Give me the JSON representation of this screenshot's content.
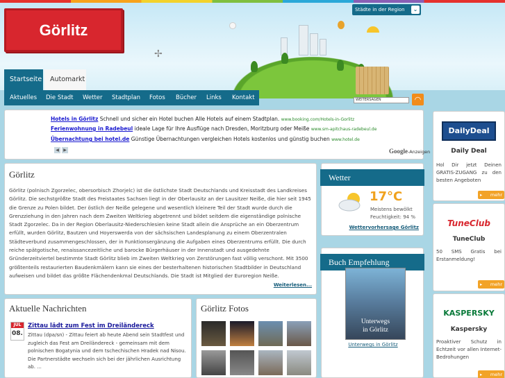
{
  "site": {
    "logo_text": "Görlitz"
  },
  "region_select": {
    "label": "Städte in der Region"
  },
  "nav_main": {
    "tabs": [
      {
        "label": "Startseite"
      },
      {
        "label": "Automarkt"
      }
    ]
  },
  "nav_sub": {
    "items": [
      {
        "label": "Aktuelles"
      },
      {
        "label": "Die Stadt"
      },
      {
        "label": "Wetter"
      },
      {
        "label": "Stadtplan"
      },
      {
        "label": "Fotos"
      },
      {
        "label": "Bücher"
      },
      {
        "label": "Links"
      },
      {
        "label": "Kontakt"
      }
    ]
  },
  "share": {
    "label": "WEITERSAGEN"
  },
  "ads": {
    "items": [
      {
        "title": "Hotels in Görlitz",
        "text": "Schnell und sicher ein Hotel buchen Alle Hotels auf einem Stadtplan.",
        "url": "www.booking.com/Hotels-in-Gorlitz"
      },
      {
        "title": "Ferienwohnung in Radebeul",
        "text": "ideale Lage für Ihre Ausflüge nach Dresden, Moritzburg oder Meiße",
        "url": "www.sm-apitchaus-radebeul.de"
      },
      {
        "title": "Übernachtung bei hotel.de",
        "text": "Günstige Übernachtungen vergleichen Hotels kostenlos und günstig buchen",
        "url": "www.hotel.de"
      }
    ],
    "credit_brand": "Google",
    "credit_text": "-Anzeigen"
  },
  "intro": {
    "title": "Görlitz",
    "text": "Görlitz (polnisch Zgorzelec, obersorbisch Zhorjelc) ist die östlichste Stadt Deutschlands und Kreisstadt des Landkreises Görlitz. Die sechstgrößte Stadt des Freistaates Sachsen liegt in der Oberlausitz an der Lausitzer Neiße, die hier seit 1945 die Grenze zu Polen bildet. Der östlich der Neiße gelegene und wesentlich kleinere Teil der Stadt wurde durch die Grenzziehung in den Jahren nach dem Zweiten Weltkrieg abgetrennt und bildet seitdem die eigenständige polnische Stadt Zgorzelec. Da in der Region Oberlausitz-Niederschlesien keine Stadt allein die Ansprüche an ein Oberzentrum erfüllt, wurden Görlitz, Bautzen und Hoyerswerda von der sächsischen Landesplanung zu einem Oberzentralen Städteverbund zusammengeschlossen, der in Funktionsergänzung die Aufgaben eines Oberzentrums erfüllt. Die durch reiche spätgotische, renaissancezeitliche und barocke Bürgerhäuser in der Innenstadt und ausgedehnte Gründerzeitviertel bestimmte Stadt Görlitz blieb im Zweiten Weltkrieg von Zerstörungen fast völlig verschont. Mit 3500 größtenteils restaurierten Baudenkmälern kann sie eines der besterhaltenen historischen Stadtbilder in Deutschland aufweisen und bildet das größte Flächendenkmal Deutschlands. Die Stadt ist Mitglied der Euroregion Neiße.",
    "more": "Weiterlesen..."
  },
  "news": {
    "title": "Aktuelle Nachrichten",
    "items": [
      {
        "month": "JUL",
        "day": "08.",
        "headline": "Zittau lädt zum Fest im Dreiländereck",
        "body": "Zittau (dpa/sn) - Zittau feiert ab heute Abend sein Stadtfest und zugleich das Fest am Dreiländereck - gemeinsam mit dem polnischen Bogatynia und dem tschechischen Hradek nad Nisou. Die Partnerstädte wechseln sich bei der jährlichen Ausrichtung ab. ..."
      }
    ]
  },
  "fotos": {
    "title": "Görlitz Fotos"
  },
  "weather": {
    "title": "Wetter",
    "temp": "17°C",
    "condition": "Meistens bewölkt",
    "humidity": "Feuchtigkeit: 94 %",
    "link": "Wettervorhersage Görlitz"
  },
  "book": {
    "title": "Buch Empfehlung",
    "cover_title_1": "Unterwegs",
    "cover_title_2": "in Görlitz",
    "link": "Unterwegs in Görlitz"
  },
  "sidebar": {
    "more_label": "mehr",
    "items": [
      {
        "logo": "DailyDeal",
        "name": "Daily Deal",
        "desc": "Hol Dir jetzt Deinen GRATIS-ZUGANG zu den besten Angeboten"
      },
      {
        "logo": "TuneClub",
        "name": "TuneClub",
        "desc": "50 SMS Gratis bei Erstanmeldung!"
      },
      {
        "logo": "KASPERSKY",
        "name": "Kaspersky",
        "desc": "Proaktiver Schutz in Echtzeit vor allen Internet-Bedrohungen"
      }
    ]
  },
  "colors": {
    "brand_red": "#d8262e",
    "nav_blue": "#156b8a",
    "accent_orange": "#f2a327",
    "page_bg": "#a9d6e5"
  }
}
